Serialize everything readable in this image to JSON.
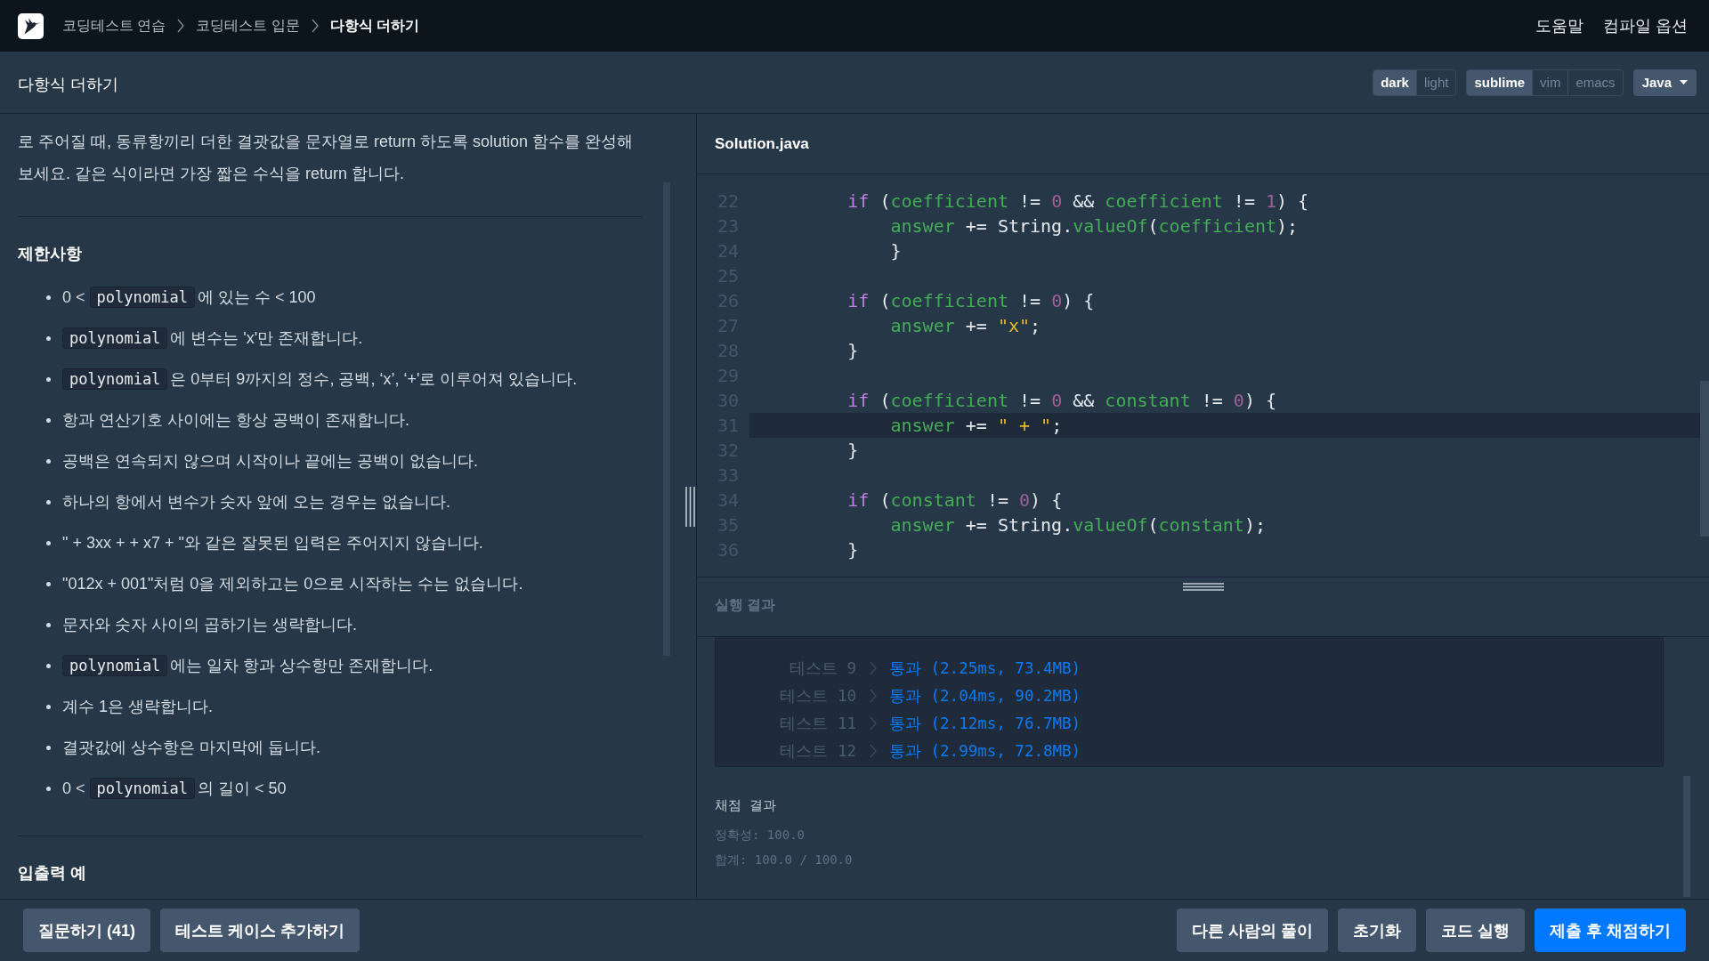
{
  "nav": {
    "breadcrumbs": [
      {
        "label": "코딩테스트 연습",
        "current": false
      },
      {
        "label": "코딩테스트 입문",
        "current": false
      },
      {
        "label": "다항식 더하기",
        "current": true
      }
    ],
    "links": [
      "도움말",
      "컴파일 옵션"
    ]
  },
  "header": {
    "title": "다항식 더하기",
    "theme_options": [
      {
        "label": "dark",
        "selected": true
      },
      {
        "label": "light",
        "selected": false
      }
    ],
    "keymap_options": [
      {
        "label": "sublime",
        "selected": true
      },
      {
        "label": "vim",
        "selected": false
      },
      {
        "label": "emacs",
        "selected": false
      }
    ],
    "language": "Java"
  },
  "description": {
    "intro": "로 주어질 때, 동류항끼리 더한 결괏값을 문자열로 return 하도록 solution 함수를 완성해보세요. 같은 식이라면 가장 짧은 수식을 return 합니다.",
    "sections": [
      {
        "title": "제한사항",
        "items": [
          {
            "parts": [
              {
                "kind": "text",
                "text": "0 < "
              },
              {
                "kind": "code",
                "text": "polynomial"
              },
              {
                "kind": "text",
                "text": "에 있는 수 < 100"
              }
            ]
          },
          {
            "parts": [
              {
                "kind": "code",
                "text": "polynomial"
              },
              {
                "kind": "text",
                "text": "에 변수는 'x'만 존재합니다."
              }
            ]
          },
          {
            "parts": [
              {
                "kind": "code",
                "text": "polynomial"
              },
              {
                "kind": "text",
                "text": "은 0부터 9까지의 정수, 공백, ‘x’, ‘+'로 이루어져 있습니다."
              }
            ]
          },
          {
            "parts": [
              {
                "kind": "text",
                "text": "항과 연산기호 사이에는 항상 공백이 존재합니다."
              }
            ]
          },
          {
            "parts": [
              {
                "kind": "text",
                "text": "공백은 연속되지 않으며 시작이나 끝에는 공백이 없습니다."
              }
            ]
          },
          {
            "parts": [
              {
                "kind": "text",
                "text": "하나의 항에서 변수가 숫자 앞에 오는 경우는 없습니다."
              }
            ]
          },
          {
            "parts": [
              {
                "kind": "text",
                "text": "\" + 3xx + + x7 + \"와 같은 잘못된 입력은 주어지지 않습니다."
              }
            ]
          },
          {
            "parts": [
              {
                "kind": "text",
                "text": "\"012x + 001\"처럼 0을 제외하고는 0으로 시작하는 수는 없습니다."
              }
            ]
          },
          {
            "parts": [
              {
                "kind": "text",
                "text": "문자와 숫자 사이의 곱하기는 생략합니다."
              }
            ]
          },
          {
            "parts": [
              {
                "kind": "code",
                "text": "polynomial"
              },
              {
                "kind": "text",
                "text": "에는 일차 항과 상수항만 존재합니다."
              }
            ]
          },
          {
            "parts": [
              {
                "kind": "text",
                "text": "계수 1은 생략합니다."
              }
            ]
          },
          {
            "parts": [
              {
                "kind": "text",
                "text": "결괏값에 상수항은 마지막에 둡니다."
              }
            ]
          },
          {
            "parts": [
              {
                "kind": "text",
                "text": "0 < "
              },
              {
                "kind": "code",
                "text": "polynomial"
              },
              {
                "kind": "text",
                "text": "의 길이 < 50"
              }
            ]
          }
        ]
      },
      {
        "title": "입출력 예"
      }
    ]
  },
  "editor": {
    "filename": "Solution.java",
    "lines": [
      {
        "number": "22",
        "current": false,
        "tokens": [
          {
            "kind": "keyword",
            "text": "        if"
          },
          {
            "kind": "plain",
            "text": " ("
          },
          {
            "kind": "variable",
            "text": "coefficient"
          },
          {
            "kind": "plain",
            "text": " != "
          },
          {
            "kind": "number",
            "text": "0"
          },
          {
            "kind": "plain",
            "text": " && "
          },
          {
            "kind": "variable",
            "text": "coefficient"
          },
          {
            "kind": "plain",
            "text": " != "
          },
          {
            "kind": "number",
            "text": "1"
          },
          {
            "kind": "plain",
            "text": ") {"
          }
        ]
      },
      {
        "number": "23",
        "current": false,
        "tokens": [
          {
            "kind": "variable",
            "text": "            answer"
          },
          {
            "kind": "plain",
            "text": " += String."
          },
          {
            "kind": "method",
            "text": "valueOf"
          },
          {
            "kind": "plain",
            "text": "("
          },
          {
            "kind": "variable",
            "text": "coefficient"
          },
          {
            "kind": "plain",
            "text": ");"
          }
        ]
      },
      {
        "number": "24",
        "current": false,
        "tokens": [
          {
            "kind": "plain",
            "text": "            }"
          }
        ]
      },
      {
        "number": "25",
        "current": false
      },
      {
        "number": "26",
        "current": false,
        "tokens": [
          {
            "kind": "keyword",
            "text": "        if"
          },
          {
            "kind": "plain",
            "text": " ("
          },
          {
            "kind": "variable",
            "text": "coefficient"
          },
          {
            "kind": "plain",
            "text": " != "
          },
          {
            "kind": "number",
            "text": "0"
          },
          {
            "kind": "plain",
            "text": ") {"
          }
        ]
      },
      {
        "number": "27",
        "current": false,
        "tokens": [
          {
            "kind": "variable",
            "text": "            answer"
          },
          {
            "kind": "plain",
            "text": " += "
          },
          {
            "kind": "string",
            "text": "\"x\""
          },
          {
            "kind": "plain",
            "text": ";"
          }
        ]
      },
      {
        "number": "28",
        "current": false,
        "tokens": [
          {
            "kind": "plain",
            "text": "        }"
          }
        ]
      },
      {
        "number": "29",
        "current": false
      },
      {
        "number": "30",
        "current": false,
        "tokens": [
          {
            "kind": "keyword",
            "text": "        if"
          },
          {
            "kind": "plain",
            "text": " ("
          },
          {
            "kind": "variable",
            "text": "coefficient"
          },
          {
            "kind": "plain",
            "text": " != "
          },
          {
            "kind": "number",
            "text": "0"
          },
          {
            "kind": "plain",
            "text": " && "
          },
          {
            "kind": "variable",
            "text": "constant"
          },
          {
            "kind": "plain",
            "text": " != "
          },
          {
            "kind": "number",
            "text": "0"
          },
          {
            "kind": "plain",
            "text": ") {"
          }
        ]
      },
      {
        "number": "31",
        "current": true,
        "tokens": [
          {
            "kind": "variable",
            "text": "            answer"
          },
          {
            "kind": "plain",
            "text": " += "
          },
          {
            "kind": "string",
            "text": "\" + \""
          },
          {
            "kind": "plain",
            "text": ";"
          }
        ]
      },
      {
        "number": "32",
        "current": false,
        "tokens": [
          {
            "kind": "plain",
            "text": "        }"
          }
        ]
      },
      {
        "number": "33",
        "current": false
      },
      {
        "number": "34",
        "current": false,
        "tokens": [
          {
            "kind": "keyword",
            "text": "        if"
          },
          {
            "kind": "plain",
            "text": " ("
          },
          {
            "kind": "variable",
            "text": "constant"
          },
          {
            "kind": "plain",
            "text": " != "
          },
          {
            "kind": "number",
            "text": "0"
          },
          {
            "kind": "plain",
            "text": ") {"
          }
        ]
      },
      {
        "number": "35",
        "current": false,
        "tokens": [
          {
            "kind": "variable",
            "text": "            answer"
          },
          {
            "kind": "plain",
            "text": " += String."
          },
          {
            "kind": "method",
            "text": "valueOf"
          },
          {
            "kind": "plain",
            "text": "("
          },
          {
            "kind": "variable",
            "text": "constant"
          },
          {
            "kind": "plain",
            "text": ");"
          }
        ]
      },
      {
        "number": "36",
        "current": false,
        "tokens": [
          {
            "kind": "plain",
            "text": "        }"
          }
        ]
      }
    ]
  },
  "results": {
    "title": "실행 결과",
    "tests": [
      {
        "label": "테스트 9",
        "result": "통과 (2.25ms, 73.4MB)",
        "passed": true
      },
      {
        "label": "테스트 10",
        "result": "통과 (2.04ms, 90.2MB)",
        "passed": true
      },
      {
        "label": "테스트 11",
        "result": "통과 (2.12ms, 76.7MB)",
        "passed": true
      },
      {
        "label": "테스트 12",
        "result": "통과 (2.99ms, 72.8MB)",
        "passed": true
      }
    ],
    "grading": {
      "title": "채점 결과",
      "lines": [
        "정확성: 100.0",
        "합계: 100.0 / 100.0"
      ]
    }
  },
  "footer": {
    "left_buttons": [
      {
        "label": "질문하기 (41)",
        "kind": "secondary"
      },
      {
        "label": "테스트 케이스 추가하기",
        "kind": "secondary"
      }
    ],
    "right_buttons": [
      {
        "label": "다른 사람의 풀이",
        "kind": "secondary"
      },
      {
        "label": "초기화",
        "kind": "secondary"
      },
      {
        "label": "코드 실행",
        "kind": "secondary"
      },
      {
        "label": "제출 후 채점하기",
        "kind": "primary"
      }
    ]
  }
}
